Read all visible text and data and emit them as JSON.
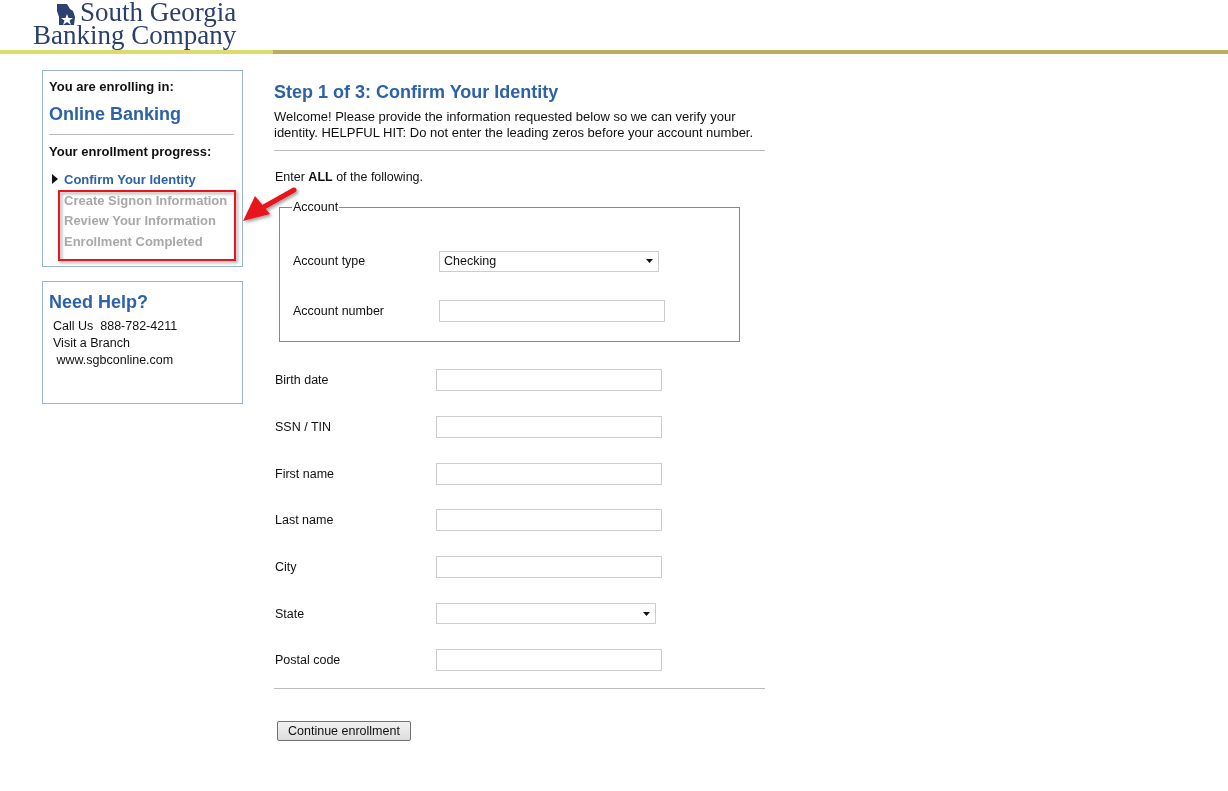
{
  "header": {
    "logo_line_1": "South Georgia",
    "logo_line_2": "Banking Company"
  },
  "sidebar": {
    "enrolling_label": "You are enrolling in:",
    "product": "Online Banking",
    "progress_label": "Your enrollment progress:",
    "steps": [
      {
        "label": "Confirm Your Identity",
        "current": true
      },
      {
        "label": "Create Signon Information",
        "current": false
      },
      {
        "label": "Review Your Information",
        "current": false
      },
      {
        "label": "Enrollment Completed",
        "current": false
      }
    ]
  },
  "help": {
    "title": "Need Help?",
    "lines": [
      "Call Us  888-782-4211",
      "Visit a Branch",
      " www.sgbconline.com"
    ]
  },
  "main": {
    "title": "Step 1 of 3: Confirm Your Identity",
    "intro": "Welcome! Please provide the information requested below so we can verify your identity. HELPFUL HIT: Do not enter the leading zeros before your account number.",
    "instruction": "Enter **ALL** of the following.",
    "account_group": {
      "legend": "Account",
      "fields": [
        {
          "label": "Account type",
          "kind": "select",
          "value": "Checking"
        },
        {
          "label": "Account number",
          "kind": "text"
        }
      ]
    },
    "fields": [
      {
        "label": "Birth date",
        "kind": "text"
      },
      {
        "label": "SSN / TIN",
        "kind": "text"
      },
      {
        "label": "First name",
        "kind": "text"
      },
      {
        "label": "Last name",
        "kind": "text"
      },
      {
        "label": "City",
        "kind": "text"
      },
      {
        "label": "State",
        "kind": "select"
      },
      {
        "label": "Postal code",
        "kind": "text"
      }
    ],
    "submit": "Continue enrollment"
  }
}
